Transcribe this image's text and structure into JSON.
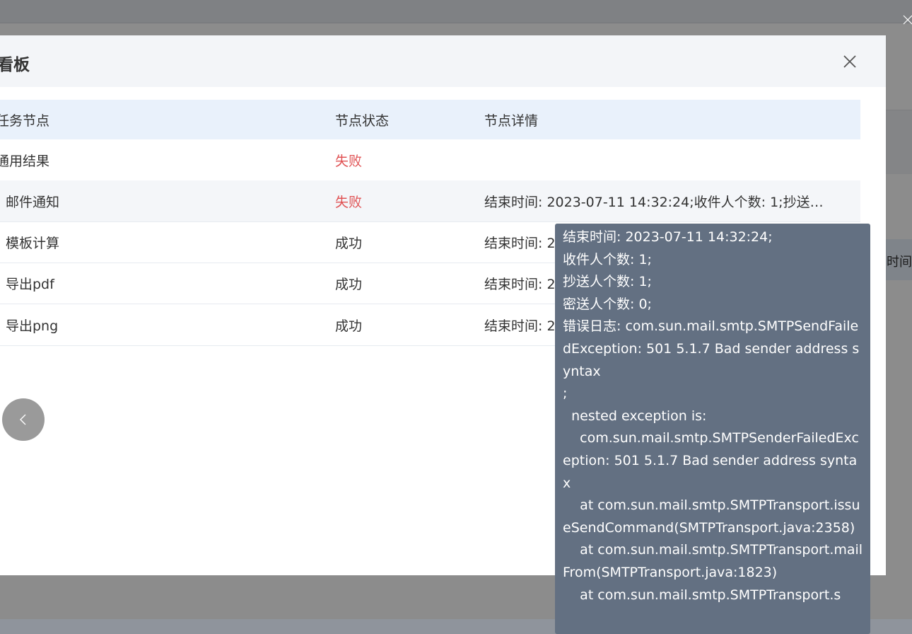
{
  "background": {
    "header_fragment": "时间"
  },
  "dialog": {
    "title": "看板",
    "columns": {
      "node": "任务节点",
      "status": "节点状态",
      "detail": "节点详情"
    },
    "rows": [
      {
        "node": "通用结果",
        "status": "失败",
        "detail": ""
      },
      {
        "node": "邮件通知",
        "status": "失败",
        "detail": "结束时间: 2023-07-11 14:32:24;收件人个数: 1;抄送…"
      },
      {
        "node": "模板计算",
        "status": "成功",
        "detail": "结束时间: 2"
      },
      {
        "node": "导出pdf",
        "status": "成功",
        "detail": "结束时间: 2"
      },
      {
        "node": "导出png",
        "status": "成功",
        "detail": "结束时间: 2"
      }
    ]
  },
  "tooltip": {
    "lines": [
      "结束时间: 2023-07-11 14:32:24;",
      "收件人个数: 1;",
      "抄送人个数: 1;",
      "密送人个数: 0;",
      "错误日志: com.sun.mail.smtp.SMTPSendFailedException: 501 5.1.7 Bad sender address syntax",
      ";",
      "  nested exception is:",
      "\tcom.sun.mail.smtp.SMTPSenderFailedException: 501 5.1.7 Bad sender address syntax",
      "\tat com.sun.mail.smtp.SMTPTransport.issueSendCommand(SMTPTransport.java:2358)",
      "\tat com.sun.mail.smtp.SMTPTransport.mailFrom(SMTPTransport.java:1823)",
      "\tat com.sun.mail.smtp.SMTPTransport.s"
    ]
  },
  "colors": {
    "fail": "#e05254",
    "tooltip_bg": "#637082",
    "header_bg": "#e9f1fb"
  }
}
